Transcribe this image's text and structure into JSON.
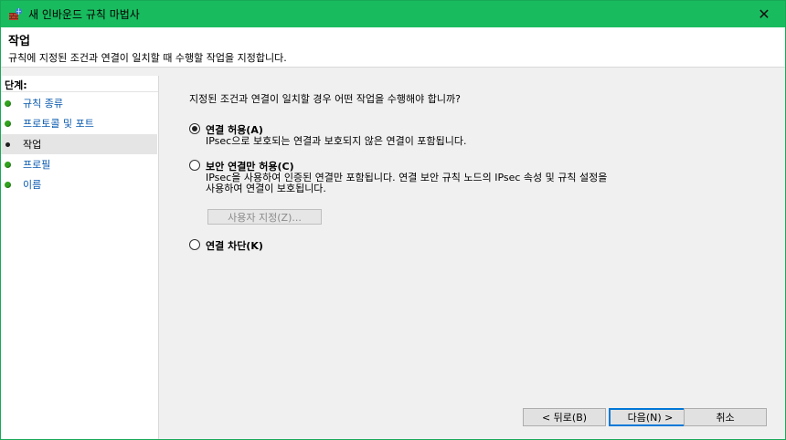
{
  "window": {
    "title": "새 인바운드 규칙 마법사",
    "close_glyph": "✕"
  },
  "header": {
    "title": "작업",
    "description": "규칙에 지정된 조건과 연결이 일치할 때 수행할 작업을 지정합니다."
  },
  "sidebar": {
    "heading": "단계:",
    "items": [
      {
        "label": "규칙 종류",
        "current": false
      },
      {
        "label": "프로토콜 및 포트",
        "current": false
      },
      {
        "label": "작업",
        "current": true
      },
      {
        "label": "프로필",
        "current": false
      },
      {
        "label": "이름",
        "current": false
      }
    ]
  },
  "main": {
    "question": "지정된 조건과 연결이 일치할 경우 어떤 작업을 수행해야 합니까?",
    "options": [
      {
        "label": "연결 허용(A)",
        "description": [
          "IPsec으로 보호되는 연결과 보호되지 않은 연결이 포함됩니다."
        ],
        "selected": true
      },
      {
        "label": "보안 연결만 허용(C)",
        "description": [
          "IPsec을 사용하여 인증된 연결만 포함됩니다. 연결 보안 규칙 노드의 IPsec 속성 및 규칙 설정을",
          "사용하여 연결이 보호됩니다."
        ],
        "selected": false
      },
      {
        "label": "연결 차단(K)",
        "description": [],
        "selected": false
      }
    ],
    "customize_button": "사용자 지정(Z)..."
  },
  "footer": {
    "back_button": "< 뒤로(B)",
    "next_button": "다음(N) >",
    "cancel_button": "취소"
  },
  "colors": {
    "titlebar": "#19bb5f",
    "link": "#0b5bb0",
    "step_dot": "#2fa31d",
    "default_button_border": "#0078d7"
  }
}
